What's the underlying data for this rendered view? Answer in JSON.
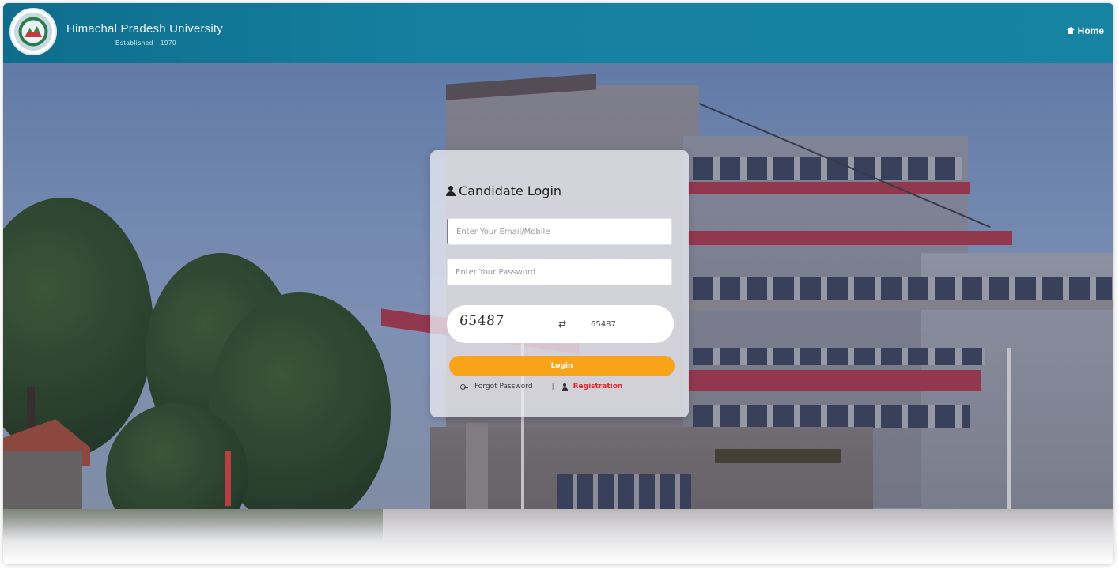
{
  "header": {
    "title": "Himachal Pradesh University",
    "subtitle": "Established - 1970",
    "home_label": "Home",
    "bar_color": "#1680a0"
  },
  "login": {
    "title": "Candidate Login",
    "email_placeholder": "Enter Your Email/Mobile",
    "password_placeholder": "Enter Your Password",
    "captcha_code": "65487",
    "captcha_input_value": "65487",
    "login_label": "Login",
    "forgot_label": "Forgot Password",
    "separator": "|",
    "register_label": "Registration",
    "accent_color": "#f9a31a",
    "register_color": "#e2252b"
  },
  "icons": {
    "home": "home-icon",
    "user": "user-icon",
    "refresh": "refresh-icon",
    "key": "key-icon",
    "user_plus": "user-plus-icon"
  }
}
